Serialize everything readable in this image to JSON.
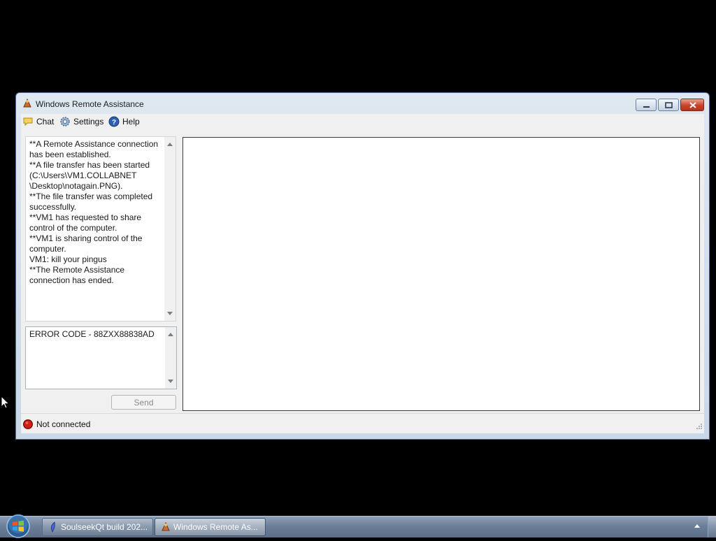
{
  "window": {
    "title": "Windows Remote Assistance"
  },
  "menu": {
    "chat": "Chat",
    "settings": "Settings",
    "help": "Help"
  },
  "chat_log": [
    "**A Remote Assistance connection has been established.",
    "**A file transfer has been started (C:\\Users\\VM1.COLLABNET \\Desktop\\notagain.PNG).",
    "**The file transfer was completed successfully.",
    "**VM1 has requested to share control of the computer.",
    "**VM1 is sharing control of the computer.",
    "VM1: kill your pingus",
    "**The Remote Assistance connection has ended."
  ],
  "message_box": {
    "value": "ERROR CODE - 88ZXX88838AD"
  },
  "send_button": "Send",
  "status": {
    "text": "Not connected",
    "color": "#d0201a"
  },
  "taskbar": {
    "items": [
      {
        "label": "SoulseekQt build 202..."
      },
      {
        "label": "Windows Remote As..."
      }
    ]
  }
}
